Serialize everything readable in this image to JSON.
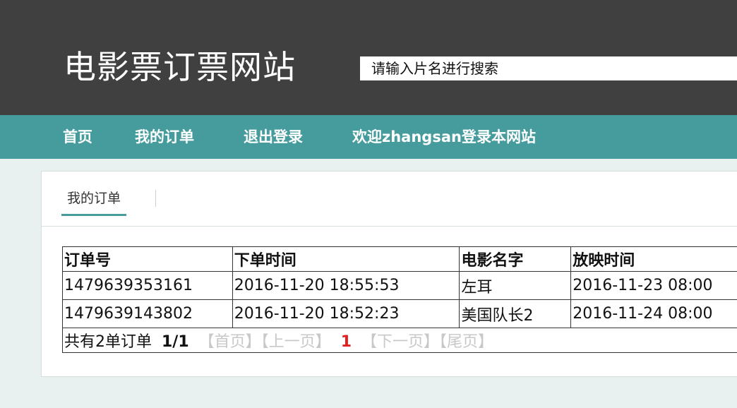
{
  "site": {
    "title": "电影票订票网站"
  },
  "search": {
    "placeholder": "请输入片名进行搜索"
  },
  "nav": {
    "home": "首页",
    "my_orders": "我的订单",
    "logout": "退出登录",
    "welcome": "欢迎zhangsan登录本网站"
  },
  "panel": {
    "tab": "我的订单"
  },
  "orders": {
    "headers": [
      "订单号",
      "下单时间",
      "电影名字",
      "放映时间"
    ],
    "rows": [
      [
        "1479639353161",
        "2016-11-20 18:55:53",
        "左耳",
        "2016-11-23 08:00"
      ],
      [
        "1479639143802",
        "2016-11-20 18:52:23",
        "美国队长2",
        "2016-11-24 08:00"
      ]
    ],
    "pager": {
      "total": "共有2单订单",
      "pageinfo": "1/1",
      "first": "【首页】",
      "prev": "【上一页】",
      "current": "1",
      "next": "【下一页】",
      "last": "【尾页】"
    }
  }
}
